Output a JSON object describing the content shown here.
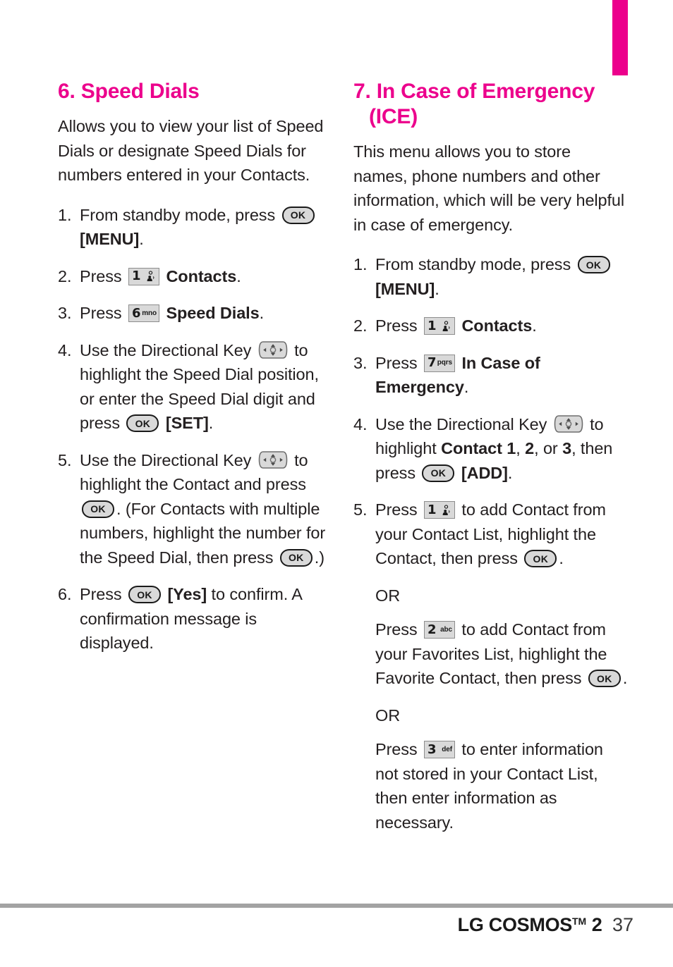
{
  "page": {
    "tab_marker_color": "#ec008c",
    "heading_color": "#ec008c",
    "footer": {
      "brand": "LG COSMOS",
      "tm": "TM",
      "model": "2",
      "page_number": "37"
    }
  },
  "left_column": {
    "heading": "6. Speed Dials",
    "intro": "Allows you to view your list of Speed Dials or designate Speed Dials for numbers entered in your Contacts.",
    "steps": [
      {
        "num": "1.",
        "parts": [
          {
            "t": "text",
            "v": "From standby mode, press "
          },
          {
            "t": "key-ok",
            "v": "OK"
          },
          {
            "t": "text",
            "v": " "
          },
          {
            "t": "bold",
            "v": "[MENU]"
          },
          {
            "t": "text",
            "v": "."
          }
        ]
      },
      {
        "num": "2.",
        "parts": [
          {
            "t": "text",
            "v": "Press "
          },
          {
            "t": "key-pad",
            "digit": "1",
            "letters": ""
          },
          {
            "t": "text",
            "v": " "
          },
          {
            "t": "bold",
            "v": "Contacts"
          },
          {
            "t": "text",
            "v": "."
          }
        ]
      },
      {
        "num": "3.",
        "parts": [
          {
            "t": "text",
            "v": "Press "
          },
          {
            "t": "key-pad",
            "digit": "6",
            "letters": "mno"
          },
          {
            "t": "text",
            "v": " "
          },
          {
            "t": "bold",
            "v": "Speed Dials"
          },
          {
            "t": "text",
            "v": "."
          }
        ]
      },
      {
        "num": "4.",
        "parts": [
          {
            "t": "text",
            "v": "Use the Directional Key "
          },
          {
            "t": "key-dir",
            "v": "directional-key"
          },
          {
            "t": "text",
            "v": " to highlight the Speed Dial position, or enter the Speed Dial digit and press "
          },
          {
            "t": "key-ok",
            "v": "OK"
          },
          {
            "t": "text",
            "v": " "
          },
          {
            "t": "bold",
            "v": "[SET]"
          },
          {
            "t": "text",
            "v": "."
          }
        ]
      },
      {
        "num": "5.",
        "parts": [
          {
            "t": "text",
            "v": "Use the Directional Key "
          },
          {
            "t": "key-dir",
            "v": "directional-key"
          },
          {
            "t": "text",
            "v": " to highlight the Contact and press "
          },
          {
            "t": "key-ok",
            "v": "OK"
          },
          {
            "t": "text",
            "v": ". (For Contacts with multiple numbers, highlight the number for the Speed Dial, then press "
          },
          {
            "t": "key-ok",
            "v": "OK"
          },
          {
            "t": "text",
            "v": ".)"
          }
        ]
      },
      {
        "num": "6.",
        "parts": [
          {
            "t": "text",
            "v": "Press "
          },
          {
            "t": "key-ok",
            "v": "OK"
          },
          {
            "t": "text",
            "v": " "
          },
          {
            "t": "bold",
            "v": "[Yes]"
          },
          {
            "t": "text",
            "v": " to confirm. A confirmation message is displayed."
          }
        ]
      }
    ]
  },
  "right_column": {
    "heading_line1": "7. In Case of Emergency",
    "heading_line2": "(ICE)",
    "intro": "This menu allows you to store names, phone numbers and other information, which will be very helpful in case of emergency.",
    "steps": [
      {
        "num": "1.",
        "parts": [
          {
            "t": "text",
            "v": "From standby mode, press "
          },
          {
            "t": "key-ok",
            "v": "OK"
          },
          {
            "t": "text",
            "v": " "
          },
          {
            "t": "bold",
            "v": "[MENU]"
          },
          {
            "t": "text",
            "v": "."
          }
        ]
      },
      {
        "num": "2.",
        "parts": [
          {
            "t": "text",
            "v": "Press "
          },
          {
            "t": "key-pad",
            "digit": "1",
            "letters": ""
          },
          {
            "t": "text",
            "v": " "
          },
          {
            "t": "bold",
            "v": "Contacts"
          },
          {
            "t": "text",
            "v": "."
          }
        ]
      },
      {
        "num": "3.",
        "parts": [
          {
            "t": "text",
            "v": "Press "
          },
          {
            "t": "key-pad",
            "digit": "7",
            "letters": "pqrs"
          },
          {
            "t": "text",
            "v": " "
          },
          {
            "t": "bold",
            "v": "In Case of Emergency"
          },
          {
            "t": "text",
            "v": "."
          }
        ]
      },
      {
        "num": "4.",
        "parts": [
          {
            "t": "text",
            "v": "Use the Directional Key "
          },
          {
            "t": "key-dir",
            "v": "directional-key"
          },
          {
            "t": "text",
            "v": " to highlight "
          },
          {
            "t": "bold",
            "v": "Contact 1"
          },
          {
            "t": "text",
            "v": ", "
          },
          {
            "t": "bold",
            "v": "2"
          },
          {
            "t": "text",
            "v": ", or "
          },
          {
            "t": "bold",
            "v": "3"
          },
          {
            "t": "text",
            "v": ", then press "
          },
          {
            "t": "key-ok",
            "v": "OK"
          },
          {
            "t": "text",
            "v": " "
          },
          {
            "t": "bold",
            "v": "[ADD]"
          },
          {
            "t": "text",
            "v": "."
          }
        ]
      },
      {
        "num": "5.",
        "parts": [
          {
            "t": "text",
            "v": "Press "
          },
          {
            "t": "key-pad",
            "digit": "1",
            "letters": ""
          },
          {
            "t": "text",
            "v": " to add Contact from your Contact List, highlight the Contact, then press "
          },
          {
            "t": "key-ok",
            "v": "OK"
          },
          {
            "t": "text",
            "v": "."
          }
        ]
      }
    ],
    "alternatives": [
      {
        "or_label": "OR",
        "parts": [
          {
            "t": "text",
            "v": "Press "
          },
          {
            "t": "key-pad",
            "digit": "2",
            "letters": "abc"
          },
          {
            "t": "text",
            "v": " to add Contact from your Favorites List, highlight the Favorite Contact, then press "
          },
          {
            "t": "key-ok",
            "v": "OK"
          },
          {
            "t": "text",
            "v": "."
          }
        ]
      },
      {
        "or_label": "OR",
        "parts": [
          {
            "t": "text",
            "v": "Press "
          },
          {
            "t": "key-pad",
            "digit": "3",
            "letters": "def"
          },
          {
            "t": "text",
            "v": " to enter information not stored in your Contact List, then enter information as necessary."
          }
        ]
      }
    ]
  }
}
